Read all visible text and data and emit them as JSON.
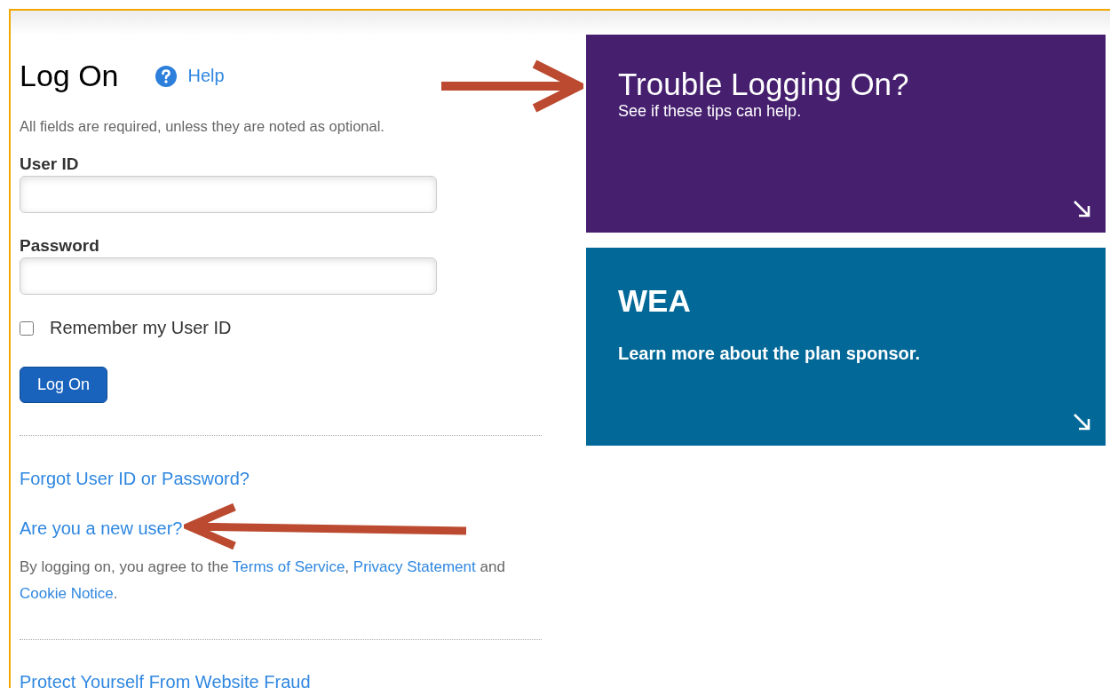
{
  "login": {
    "title": "Log On",
    "help_link": "Help",
    "note": "All fields are required, unless they are noted as optional.",
    "fields": [
      {
        "label": "User ID"
      },
      {
        "label": "Password"
      }
    ],
    "remember": {
      "label": "Remember my User ID",
      "checked": false
    },
    "submit": "Log On",
    "links": [
      "Forgot User ID or Password?",
      "Are you a new user?"
    ],
    "agreement": [
      {
        "kind": "text",
        "text": "By logging on, you agree to the "
      },
      {
        "kind": "link",
        "text": "Terms of Service"
      },
      {
        "kind": "text",
        "text": ", "
      },
      {
        "kind": "link",
        "text": "Privacy Statement"
      },
      {
        "kind": "text",
        "text": " and "
      },
      {
        "kind": "link",
        "text": "Cookie Notice"
      },
      {
        "kind": "text",
        "text": "."
      }
    ],
    "fraud_link": "Protect Yourself From Website Fraud"
  },
  "tiles": [
    {
      "kind": "light",
      "title": "Trouble Logging On?",
      "subtitle": "See if these tips can help.",
      "color": "#46206f"
    },
    {
      "kind": "bold",
      "title": "WEA",
      "subtitle": "Learn more about the plan sponsor.",
      "color": "#016898"
    }
  ]
}
